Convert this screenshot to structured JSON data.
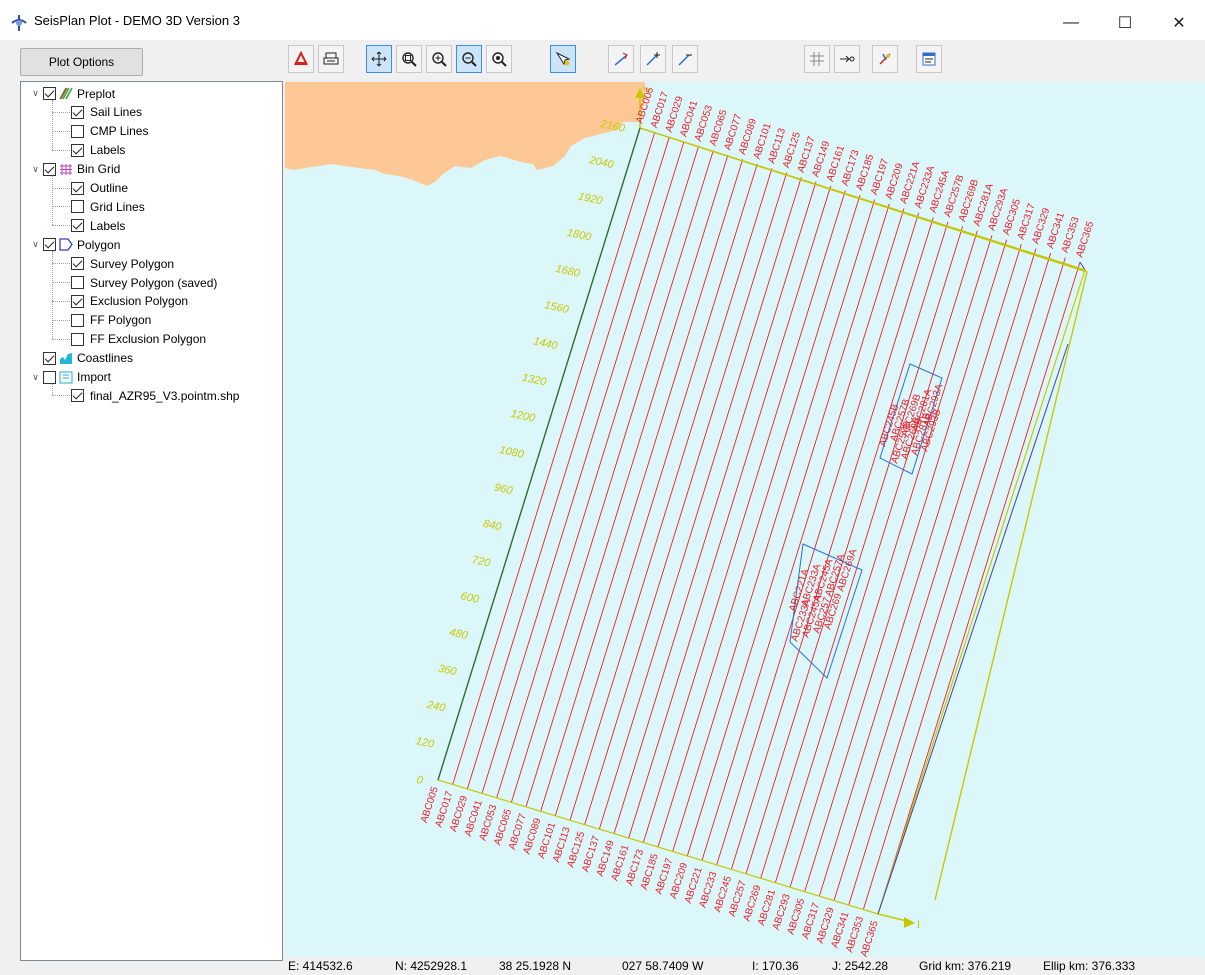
{
  "window": {
    "title": "SeisPlan Plot - DEMO 3D Version 3",
    "minimize": "—",
    "maximize": "☐",
    "close": "✕"
  },
  "sidebar": {
    "plot_options_label": "Plot Options",
    "tree": [
      {
        "label": "Preplot",
        "checked": true,
        "level": 0,
        "icon": "preplot-icon",
        "expanded": true
      },
      {
        "label": "Sail Lines",
        "checked": true,
        "level": 1
      },
      {
        "label": "CMP Lines",
        "checked": false,
        "level": 1
      },
      {
        "label": "Labels",
        "checked": true,
        "level": 1
      },
      {
        "label": "Bin Grid",
        "checked": true,
        "level": 0,
        "icon": "bin-grid-icon",
        "expanded": true
      },
      {
        "label": "Outline",
        "checked": true,
        "level": 1
      },
      {
        "label": "Grid Lines",
        "checked": false,
        "level": 1
      },
      {
        "label": "Labels",
        "checked": true,
        "level": 1
      },
      {
        "label": "Polygon",
        "checked": true,
        "level": 0,
        "icon": "polygon-icon",
        "expanded": true
      },
      {
        "label": "Survey Polygon",
        "checked": true,
        "level": 1
      },
      {
        "label": "Survey Polygon (saved)",
        "checked": false,
        "level": 1
      },
      {
        "label": "Exclusion Polygon",
        "checked": true,
        "level": 1
      },
      {
        "label": "FF Polygon",
        "checked": false,
        "level": 1
      },
      {
        "label": "FF Exclusion Polygon",
        "checked": false,
        "level": 1
      },
      {
        "label": "Coastlines",
        "checked": true,
        "level": 0,
        "icon": "coastline-icon",
        "expanded": null
      },
      {
        "label": "Import",
        "checked": false,
        "level": 0,
        "icon": "import-icon",
        "expanded": true
      },
      {
        "label": "final_AZR95_V3.pointm.shp",
        "checked": true,
        "level": 1
      }
    ]
  },
  "toolbar": {
    "buttons": [
      {
        "name": "export-pdf",
        "icon": "pdf-icon",
        "active": false
      },
      {
        "name": "print",
        "icon": "print-icon",
        "active": false
      },
      {
        "name": "pan",
        "icon": "pan-icon",
        "active": true
      },
      {
        "name": "zoom-window",
        "icon": "zoom-window-icon",
        "active": false
      },
      {
        "name": "zoom-in",
        "icon": "zoom-in-icon",
        "active": false
      },
      {
        "name": "zoom-out",
        "icon": "zoom-out-icon",
        "active": true
      },
      {
        "name": "zoom-extents",
        "icon": "zoom-extents-icon",
        "active": false
      },
      {
        "name": "select",
        "icon": "select-icon",
        "active": true
      },
      {
        "name": "line-tool",
        "icon": "line-tool-icon",
        "active": false
      },
      {
        "name": "line-add",
        "icon": "line-add-icon",
        "active": false
      },
      {
        "name": "line-remove",
        "icon": "line-remove-icon",
        "active": false
      },
      {
        "name": "grid-toggle",
        "icon": "grid-icon",
        "active": false
      },
      {
        "name": "goto-point",
        "icon": "goto-icon",
        "active": false
      },
      {
        "name": "measure",
        "icon": "measure-icon",
        "active": false
      },
      {
        "name": "properties",
        "icon": "properties-icon",
        "active": false
      }
    ]
  },
  "map": {
    "colors": {
      "water": "#dcf7fa",
      "land": "#fdc896",
      "sail_line": "#e8202a",
      "outline": "#c8c800",
      "polygon": "#2f6fd0",
      "grid_label": "#c8c800",
      "line_label": "#e8202a"
    },
    "bottom_labels": [
      "ABC005",
      "ABC017",
      "ABC029",
      "ABC041",
      "ABC053",
      "ABC065",
      "ABC077",
      "ABC089",
      "ABC101",
      "ABC113",
      "ABC125",
      "ABC137",
      "ABC149",
      "ABC161",
      "ABC173",
      "ABC185",
      "ABC197",
      "ABC209",
      "ABC221",
      "ABC233",
      "ABC245",
      "ABC257",
      "ABC269",
      "ABC281",
      "ABC293",
      "ABC305",
      "ABC317",
      "ABC329",
      "ABC341",
      "ABC353",
      "ABC365"
    ],
    "top_labels": [
      "ABC005",
      "ABC017",
      "ABC029",
      "ABC041",
      "ABC053",
      "ABC065",
      "ABC077",
      "ABC089",
      "ABC101",
      "ABC113",
      "ABC125",
      "ABC137",
      "ABC149",
      "ABC161",
      "ABC173",
      "ABC185",
      "ABC197",
      "ABC209",
      "ABC221A",
      "ABC233A",
      "ABC245A",
      "ABC257B",
      "ABC269B",
      "ABC281A",
      "ABC293A",
      "ABC305",
      "ABC317",
      "ABC329",
      "ABC341",
      "ABC353",
      "ABC365"
    ],
    "grid_labels": [
      "0",
      "120",
      "240",
      "360",
      "480",
      "600",
      "720",
      "840",
      "960",
      "1080",
      "1200",
      "1320",
      "1440",
      "1560",
      "1680",
      "1800",
      "1920",
      "2040",
      "2160"
    ],
    "poly1_labels": [
      "ABC245B",
      "ABC257B",
      "ABC269B",
      "ABC281A",
      "ABC293A"
    ],
    "poly2_labels": [
      "ABC221A",
      "ABC233A",
      "ABC245A",
      "ABC257A",
      "ABC269A"
    ],
    "poly1_lower_labels": [
      "ABC257B",
      "ABC269B",
      "ABC281B",
      "ABC293B"
    ],
    "poly2_lower_labels": [
      "ABC233A",
      "ABC245A",
      "ABC257",
      "ABC269"
    ],
    "axis_i_label": "I",
    "axis_j_label": "J"
  },
  "status": {
    "easting": "E: 414532.6",
    "northing": "N: 4252928.1",
    "latitude": "38 25.1928 N",
    "longitude": "027 58.7409 W",
    "i": "I: 170.36",
    "j": "J: 2542.28",
    "grid_km": "Grid km: 376.219",
    "ellip_km": "Ellip km: 376.333"
  }
}
